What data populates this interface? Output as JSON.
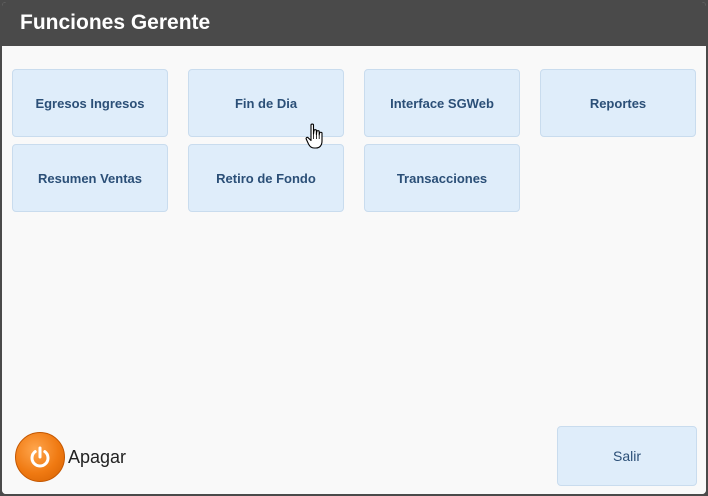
{
  "window": {
    "title": "Funciones Gerente"
  },
  "functions": [
    {
      "label": "Egresos Ingresos"
    },
    {
      "label": "Fin de Dia"
    },
    {
      "label": "Interface SGWeb"
    },
    {
      "label": "Reportes"
    },
    {
      "label": "Resumen Ventas"
    },
    {
      "label": "Retiro de Fondo"
    },
    {
      "label": "Transacciones"
    }
  ],
  "footer": {
    "power_label": "Apagar",
    "power_icon": "power-icon",
    "exit_label": "Salir"
  },
  "colors": {
    "titlebar": "#4a4a4a",
    "button_bg": "#dfedfa",
    "button_text": "#2b4f77",
    "power_orange": "#f07a12"
  }
}
